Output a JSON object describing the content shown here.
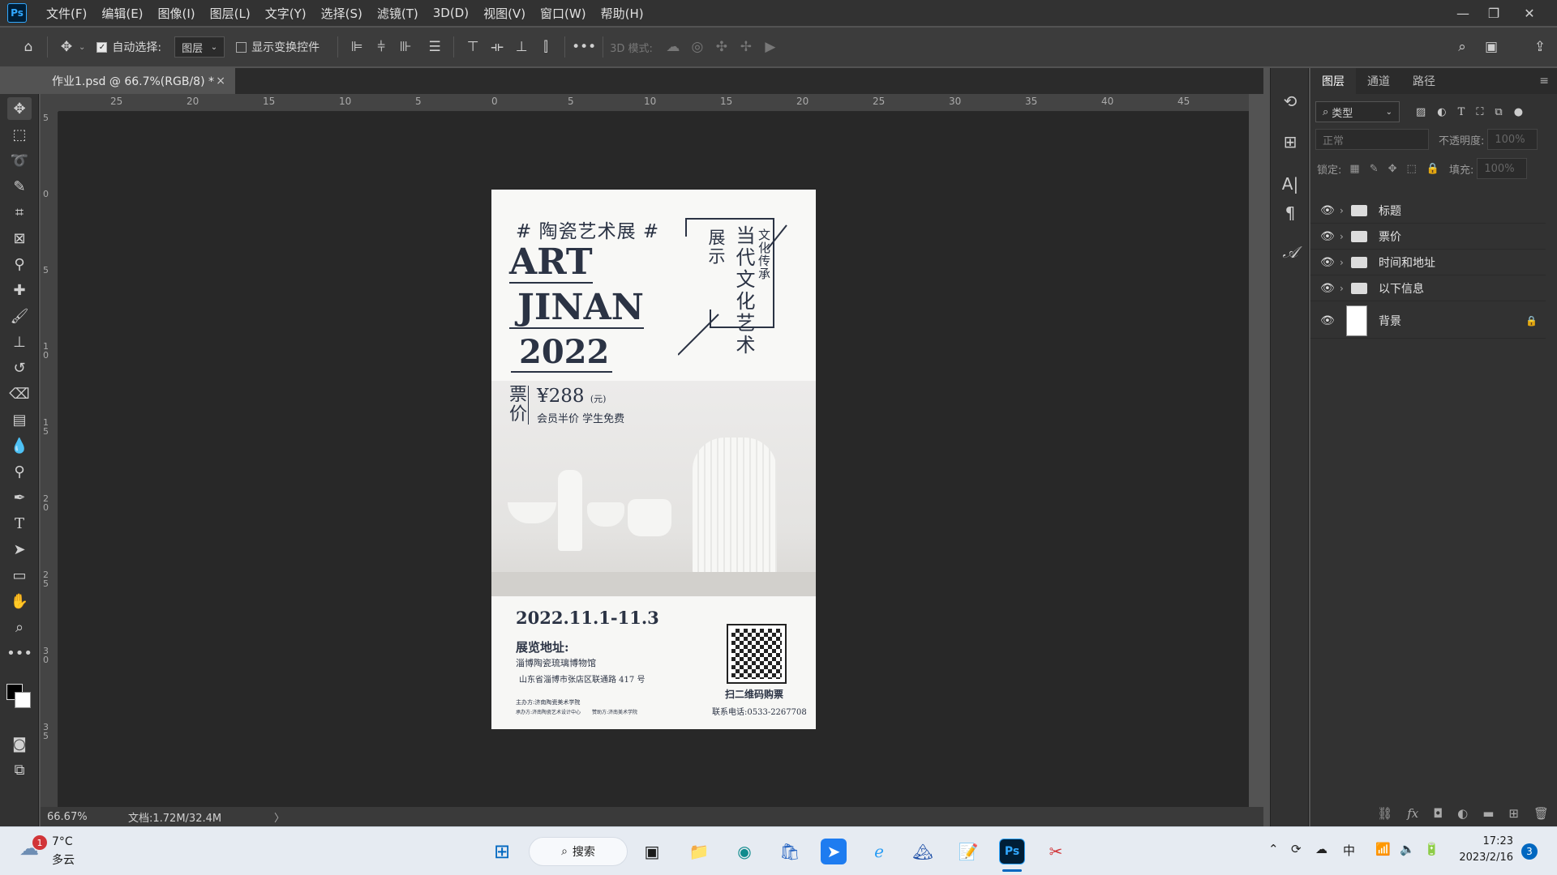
{
  "menubar": {
    "app_icon": "Ps",
    "items": [
      "文件(F)",
      "编辑(E)",
      "图像(I)",
      "图层(L)",
      "文字(Y)",
      "选择(S)",
      "滤镜(T)",
      "3D(D)",
      "视图(V)",
      "窗口(W)",
      "帮助(H)"
    ]
  },
  "options_bar": {
    "auto_select_label": "自动选择:",
    "auto_select_target": "图层",
    "show_transform_label": "显示变换控件",
    "mode_3d_label": "3D 模式:"
  },
  "document_tab": {
    "title": "作业1.psd @ 66.7%(RGB/8) *",
    "close": "×"
  },
  "ruler": {
    "top_ticks": [
      "25",
      "20",
      "15",
      "10",
      "5",
      "0",
      "5",
      "10",
      "15",
      "20",
      "25",
      "30",
      "35",
      "40",
      "45"
    ],
    "left_ticks": [
      "5",
      "0",
      "5",
      "1\n0",
      "1\n5",
      "2\n0",
      "2\n5",
      "3\n0",
      "3\n5"
    ]
  },
  "status": {
    "zoom": "66.67%",
    "doc_info": "文档:1.72M/32.4M",
    "arrow": "〉"
  },
  "poster": {
    "hashtag_title": "# 陶瓷艺术展 #",
    "art": "ART",
    "jinan": "JINAN",
    "year": "2022",
    "vertical_1": "展示",
    "vertical_2": "当代文化艺术",
    "vertical_3": "文化传承",
    "price_label": "票价",
    "price": "¥288",
    "price_unit": "(元)",
    "price_note": "会员半价  学生免费",
    "date": "2022.11.1-11.3",
    "address_label": "展览地址:",
    "venue": "淄博陶瓷琉璃博物馆",
    "address": "山东省淄博市张店区联通路 417 号",
    "organizer": "主办方:济南陶瓷美术学院",
    "co_organizer": "承办方:济南陶瓷艺术设计中心",
    "support": "赞助方:济南美术学院",
    "qr_label": "扫二维码购票",
    "contact": "联系电话:0533-2267708"
  },
  "layers_panel": {
    "tabs": [
      "图层",
      "通道",
      "路径"
    ],
    "filter_kind": "类型",
    "blend_mode": "正常",
    "opacity_label": "不透明度:",
    "opacity_value": "100%",
    "lock_label": "锁定:",
    "fill_label": "填充:",
    "fill_value": "100%",
    "layers": [
      {
        "name": "标题",
        "type": "group"
      },
      {
        "name": "票价",
        "type": "group"
      },
      {
        "name": "时间和地址",
        "type": "group"
      },
      {
        "name": "以下信息",
        "type": "group"
      },
      {
        "name": "背景",
        "type": "background",
        "locked": true
      }
    ]
  },
  "taskbar": {
    "weather_temp": "7°C",
    "weather_desc": "多云",
    "weather_badge": "1",
    "search_label": "搜索",
    "ime": "中",
    "time": "17:23",
    "date": "2023/2/16",
    "notif_count": "3"
  },
  "colors": {
    "accent_blue": "#31a8ff",
    "poster_navy": "#2b3344"
  }
}
